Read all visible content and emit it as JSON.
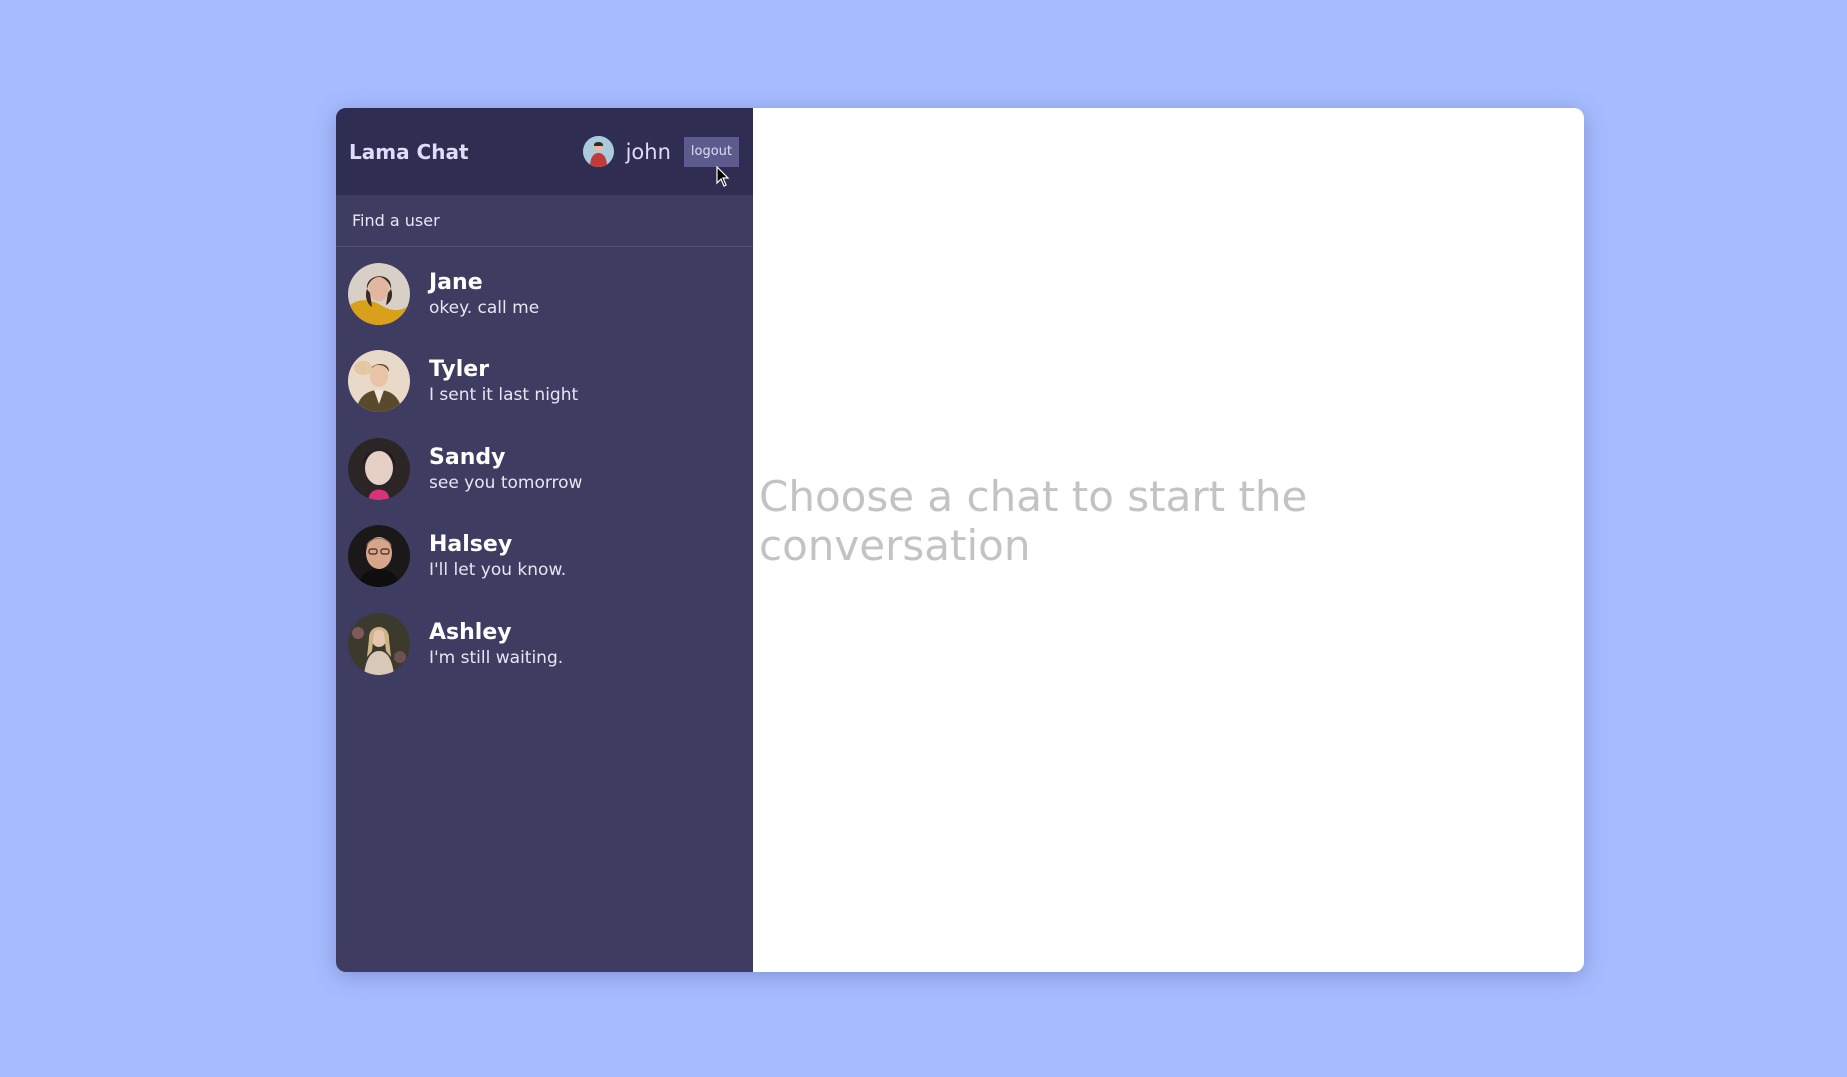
{
  "app": {
    "title": "Lama Chat"
  },
  "current_user": {
    "name": "john",
    "logout_label": "logout"
  },
  "search": {
    "placeholder": "Find a user"
  },
  "chats": [
    {
      "name": "Jane",
      "last_message": "okey. call me"
    },
    {
      "name": "Tyler",
      "last_message": "I sent it last night"
    },
    {
      "name": "Sandy",
      "last_message": "see you tomorrow"
    },
    {
      "name": "Halsey",
      "last_message": "I'll let you know."
    },
    {
      "name": "Ashley",
      "last_message": "I'm still waiting."
    }
  ],
  "main": {
    "empty_message": "Choose a chat to start the conversation"
  },
  "colors": {
    "background": "#a7bcff",
    "sidebar": "#3e3c61",
    "navbar": "#2f2d52",
    "logout_button": "#5d5b8d",
    "empty_text": "#c3c3c3"
  }
}
